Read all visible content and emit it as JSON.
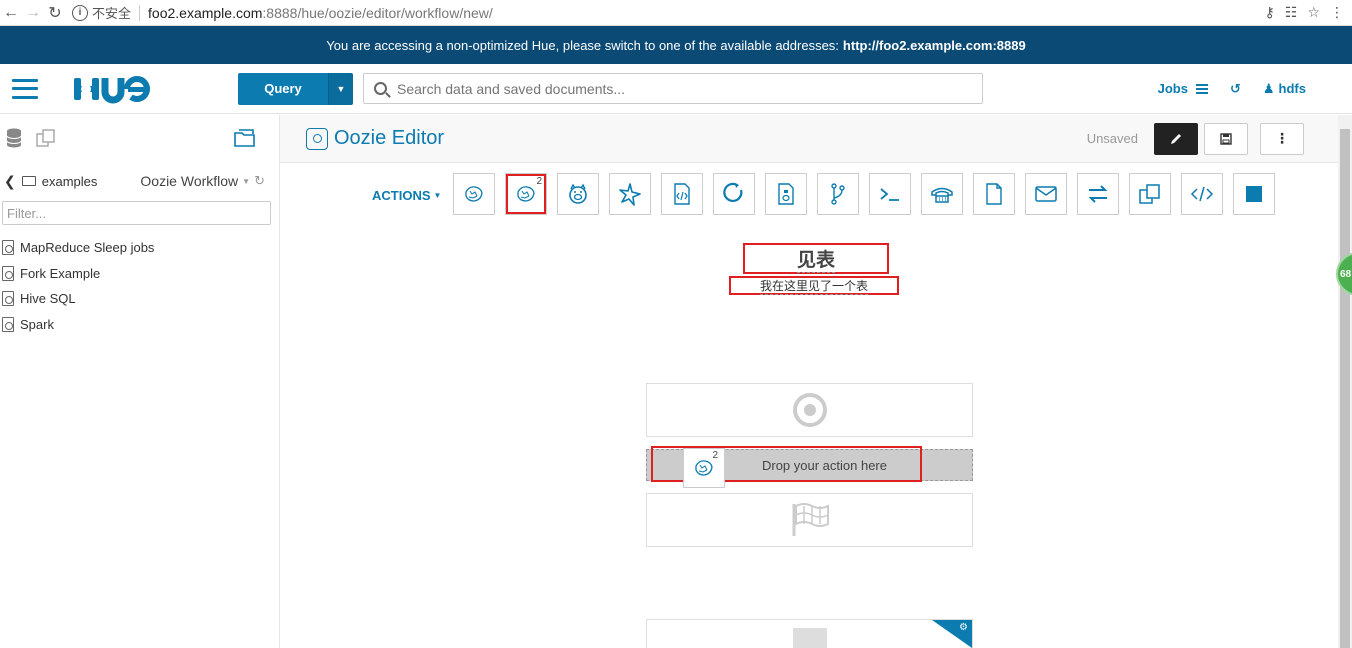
{
  "browser": {
    "security_label": "不安全",
    "url_host": "foo2.example.com",
    "url_path": ":8888/hue/oozie/editor/workflow/new/"
  },
  "banner": {
    "text": "You are accessing a non-optimized Hue, please switch to one of the available addresses:",
    "link": "http://foo2.example.com:8889"
  },
  "topnav": {
    "query_label": "Query",
    "search_placeholder": "Search data and saved documents...",
    "jobs_label": "Jobs",
    "user_label": "hdfs"
  },
  "leftpanel": {
    "folder": "examples",
    "doc_type": "Oozie Workflow",
    "filter_placeholder": "Filter...",
    "items": [
      {
        "label": "MapReduce Sleep jobs"
      },
      {
        "label": "Fork Example"
      },
      {
        "label": "Hive SQL"
      },
      {
        "label": "Spark"
      }
    ]
  },
  "editor": {
    "title": "Oozie Editor",
    "status": "Unsaved",
    "actions_label": "ACTIONS"
  },
  "workflow": {
    "name": "见表",
    "description": "我在这里见了一个表",
    "drop_text": "Drop your action here"
  },
  "badges": {
    "hive2_superscript": "2",
    "bubble": "68"
  },
  "colors": {
    "accent": "#0b7bb0",
    "banner": "#0b4a75",
    "highlight": "#e02020"
  },
  "icons": [
    "hive-icon",
    "hive2-icon",
    "pig-icon",
    "spark-icon",
    "java-icon",
    "subworkflow-icon",
    "sqoop-icon",
    "fork-icon",
    "shell-icon",
    "ssh-icon",
    "fs-icon",
    "email-icon",
    "distcp-icon",
    "streaming-icon",
    "generic-icon",
    "kill-icon"
  ]
}
